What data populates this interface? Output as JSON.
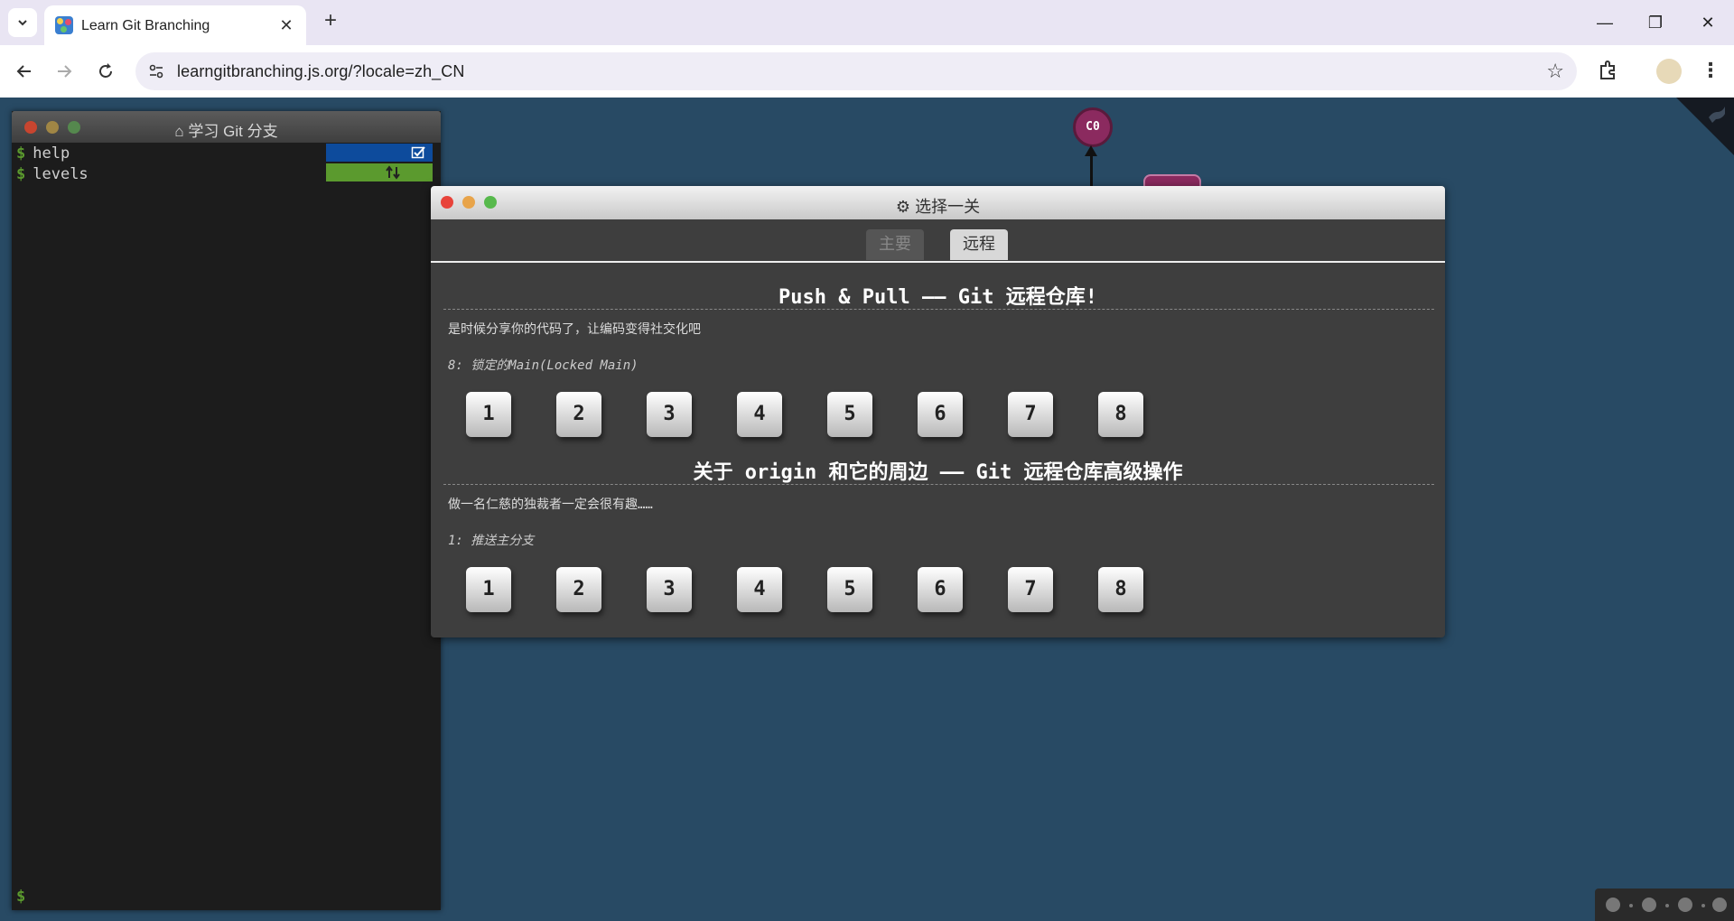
{
  "browser": {
    "tab_title": "Learn Git Branching",
    "url": "learngitbranching.js.org/?locale=zh_CN"
  },
  "commit": {
    "label": "C0"
  },
  "terminal": {
    "title": "学习 Git 分支",
    "lines": [
      {
        "prompt": "$",
        "command": "help"
      },
      {
        "prompt": "$",
        "command": "levels"
      }
    ],
    "input_prompt": "$"
  },
  "dialog": {
    "title": "选择一关",
    "tabs": [
      {
        "label": "主要",
        "active": false
      },
      {
        "label": "远程",
        "active": true
      }
    ],
    "sequences": [
      {
        "title": "Push & Pull —— Git 远程仓库!",
        "about": "是时候分享你的代码了，让编码变得社交化吧",
        "level_name": "8: 锁定的Main(Locked Main)",
        "levels": [
          "1",
          "2",
          "3",
          "4",
          "5",
          "6",
          "7",
          "8"
        ]
      },
      {
        "title": "关于 origin 和它的周边 —— Git 远程仓库高级操作",
        "about": "做一名仁慈的独裁者一定会很有趣……",
        "level_name": "1: 推送主分支",
        "levels": [
          "1",
          "2",
          "3",
          "4",
          "5",
          "6",
          "7",
          "8"
        ]
      }
    ]
  },
  "colors": {
    "page_bg": "#284a64",
    "prompt": "#5b9a2e",
    "commit": "#8b2a5f"
  }
}
